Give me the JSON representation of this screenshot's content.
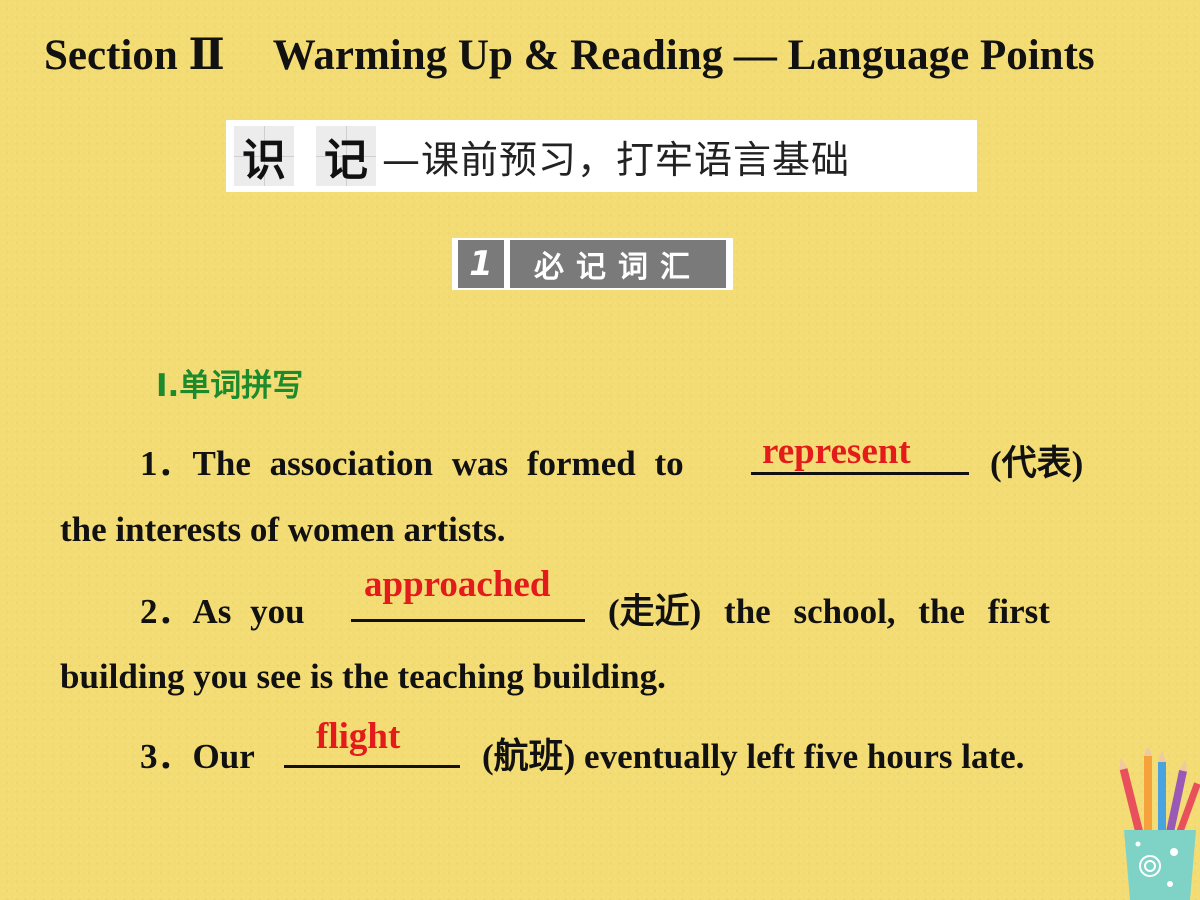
{
  "title": {
    "section": "Section Ⅱ",
    "heading": "Warming Up & Reading — Language Points"
  },
  "banner": {
    "char1": "识",
    "char2": "记",
    "subtitle": "—课前预习，打牢语言基础"
  },
  "vocab_tag": {
    "number": "1",
    "label": "必记词汇"
  },
  "section_heading": "Ⅰ.单词拼写",
  "questions": [
    {
      "num": "1．",
      "before": "The association was formed to",
      "answer": "represent",
      "after": "(代表)",
      "line2": "the interests of women artists."
    },
    {
      "num": "2．",
      "before": "As you",
      "answer": "approached",
      "after": "(走近) the school, the first",
      "line2": "building you see is the teaching building."
    },
    {
      "num": "3．",
      "before": "Our",
      "answer": "flight",
      "after": "(航班) eventually left five hours late."
    }
  ],
  "decoration": {
    "icon": "pencil-cup-icon",
    "cup_color": "#7fd3c6"
  },
  "colors": {
    "background": "#f3dc74",
    "answer": "#e31b1b",
    "heading": "#1d8a2c"
  }
}
